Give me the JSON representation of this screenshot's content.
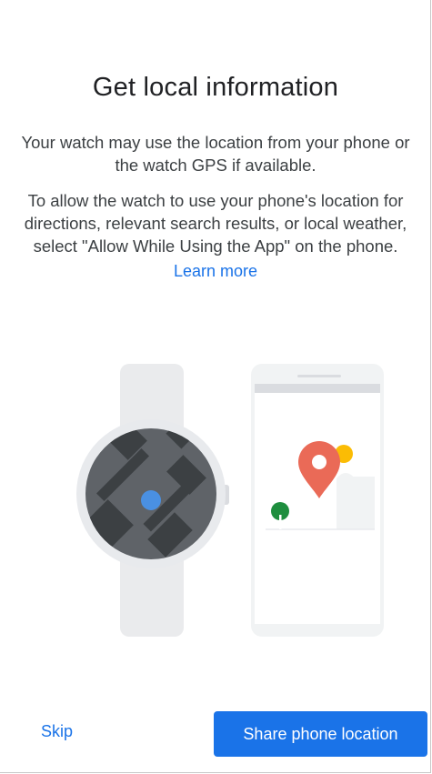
{
  "onboarding": {
    "title": "Get local information",
    "paragraph1": "Your watch may use the location from your phone or the watch GPS if available.",
    "paragraph2": "To allow the watch to use your phone's location for directions, relevant search results, or local weather, select \"Allow While Using the App\" on the phone.",
    "learn_more_label": "Learn more"
  },
  "illustration": {
    "watch_icon": "watch-icon",
    "phone_icon": "phone-icon",
    "map_pin_icon": "map-pin-icon",
    "tree_icon": "tree-icon",
    "sun_icon": "sun-icon"
  },
  "footer": {
    "skip_label": "Skip",
    "share_label": "Share phone location"
  },
  "colors": {
    "accent": "#1a73e8",
    "pin": "#ea6a57",
    "sun": "#fbbc04",
    "tree": "#1e8e3e",
    "watch_face": "#5f6368"
  }
}
